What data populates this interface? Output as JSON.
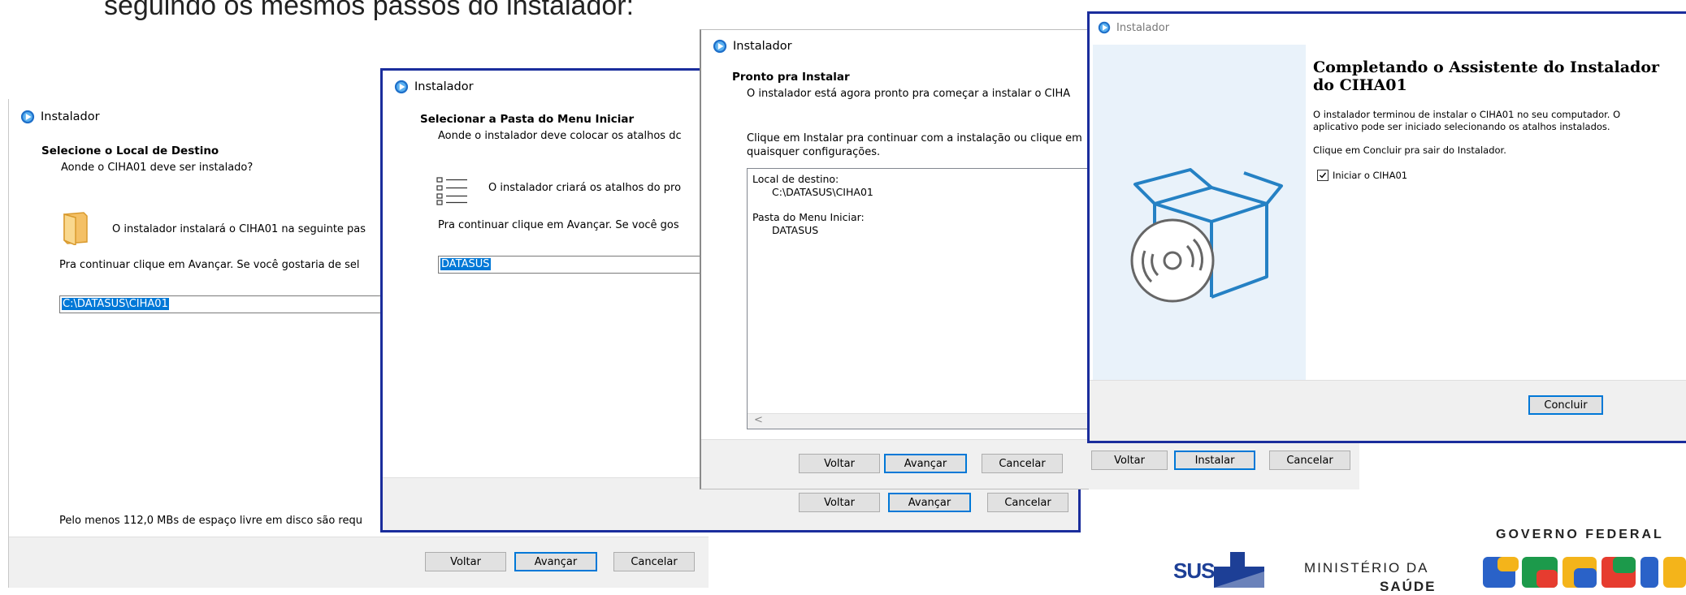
{
  "slide": {
    "heading": "seguindo os mesmos passos do instalador:"
  },
  "window_title": "Instalador",
  "buttons": {
    "back": "Voltar",
    "next": "Avançar",
    "cancel": "Cancelar",
    "install": "Instalar",
    "finish": "Concluir"
  },
  "step1": {
    "heading": "Selecione o Local de Destino",
    "subheading": "Aonde o CIHA01 deve ser instalado?",
    "info": "O instalador instalará o CIHA01 na seguinte pas",
    "continue_text": "Pra continuar clique em Avançar. Se você gostaria de sel",
    "path_value": "C:\\DATASUS\\CIHA01",
    "disk_space": "Pelo menos 112,0 MBs de espaço livre em disco são requ"
  },
  "step2": {
    "heading": "Selecionar a Pasta do Menu Iniciar",
    "subheading": "Aonde o instalador deve colocar os atalhos dc",
    "info": "O instalador criará os atalhos do pro",
    "continue_text": "Pra continuar clique em Avançar. Se você gos",
    "folder_value": "DATASUS"
  },
  "step3": {
    "heading": "Pronto pra Instalar",
    "subheading": "O instalador está agora pronto pra começar a instalar o CIHA",
    "instruction_line1": "Clique em Instalar pra continuar com a instalação ou clique em",
    "instruction_line2": "quaisquer configurações.",
    "memo": {
      "dest_label": "Local de destino:",
      "dest_value": "C:\\DATASUS\\CIHA01",
      "menu_label": "Pasta do Menu Iniciar:",
      "menu_value": "DATASUS",
      "scroll_left": "<"
    }
  },
  "step4": {
    "heading_line1": "Completando o Assistente do Instalador",
    "heading_line2": "do CIHA01",
    "desc_line1": "O instalador terminou de instalar o CIHA01 no seu computador. O",
    "desc_line2": "aplicativo pode ser iniciado selecionando os atalhos instalados.",
    "desc_line3": "Clique em Concluir pra sair do Instalador.",
    "checkbox_label": "Iniciar o CIHA01",
    "checkbox_checked": true
  },
  "logos": {
    "governo_federal": "GOVERNO FEDERAL",
    "sus": "SUS",
    "ministerio_line1": "MINISTÉRIO DA",
    "ministerio_line2": "SAÚDE"
  },
  "colors": {
    "accent_blue": "#0078d7",
    "window_border": "#1a2d9c",
    "footer_gray": "#f0f0f0",
    "sidebar_blue": "#e9f2fa",
    "box_blue": "#2581c4"
  }
}
